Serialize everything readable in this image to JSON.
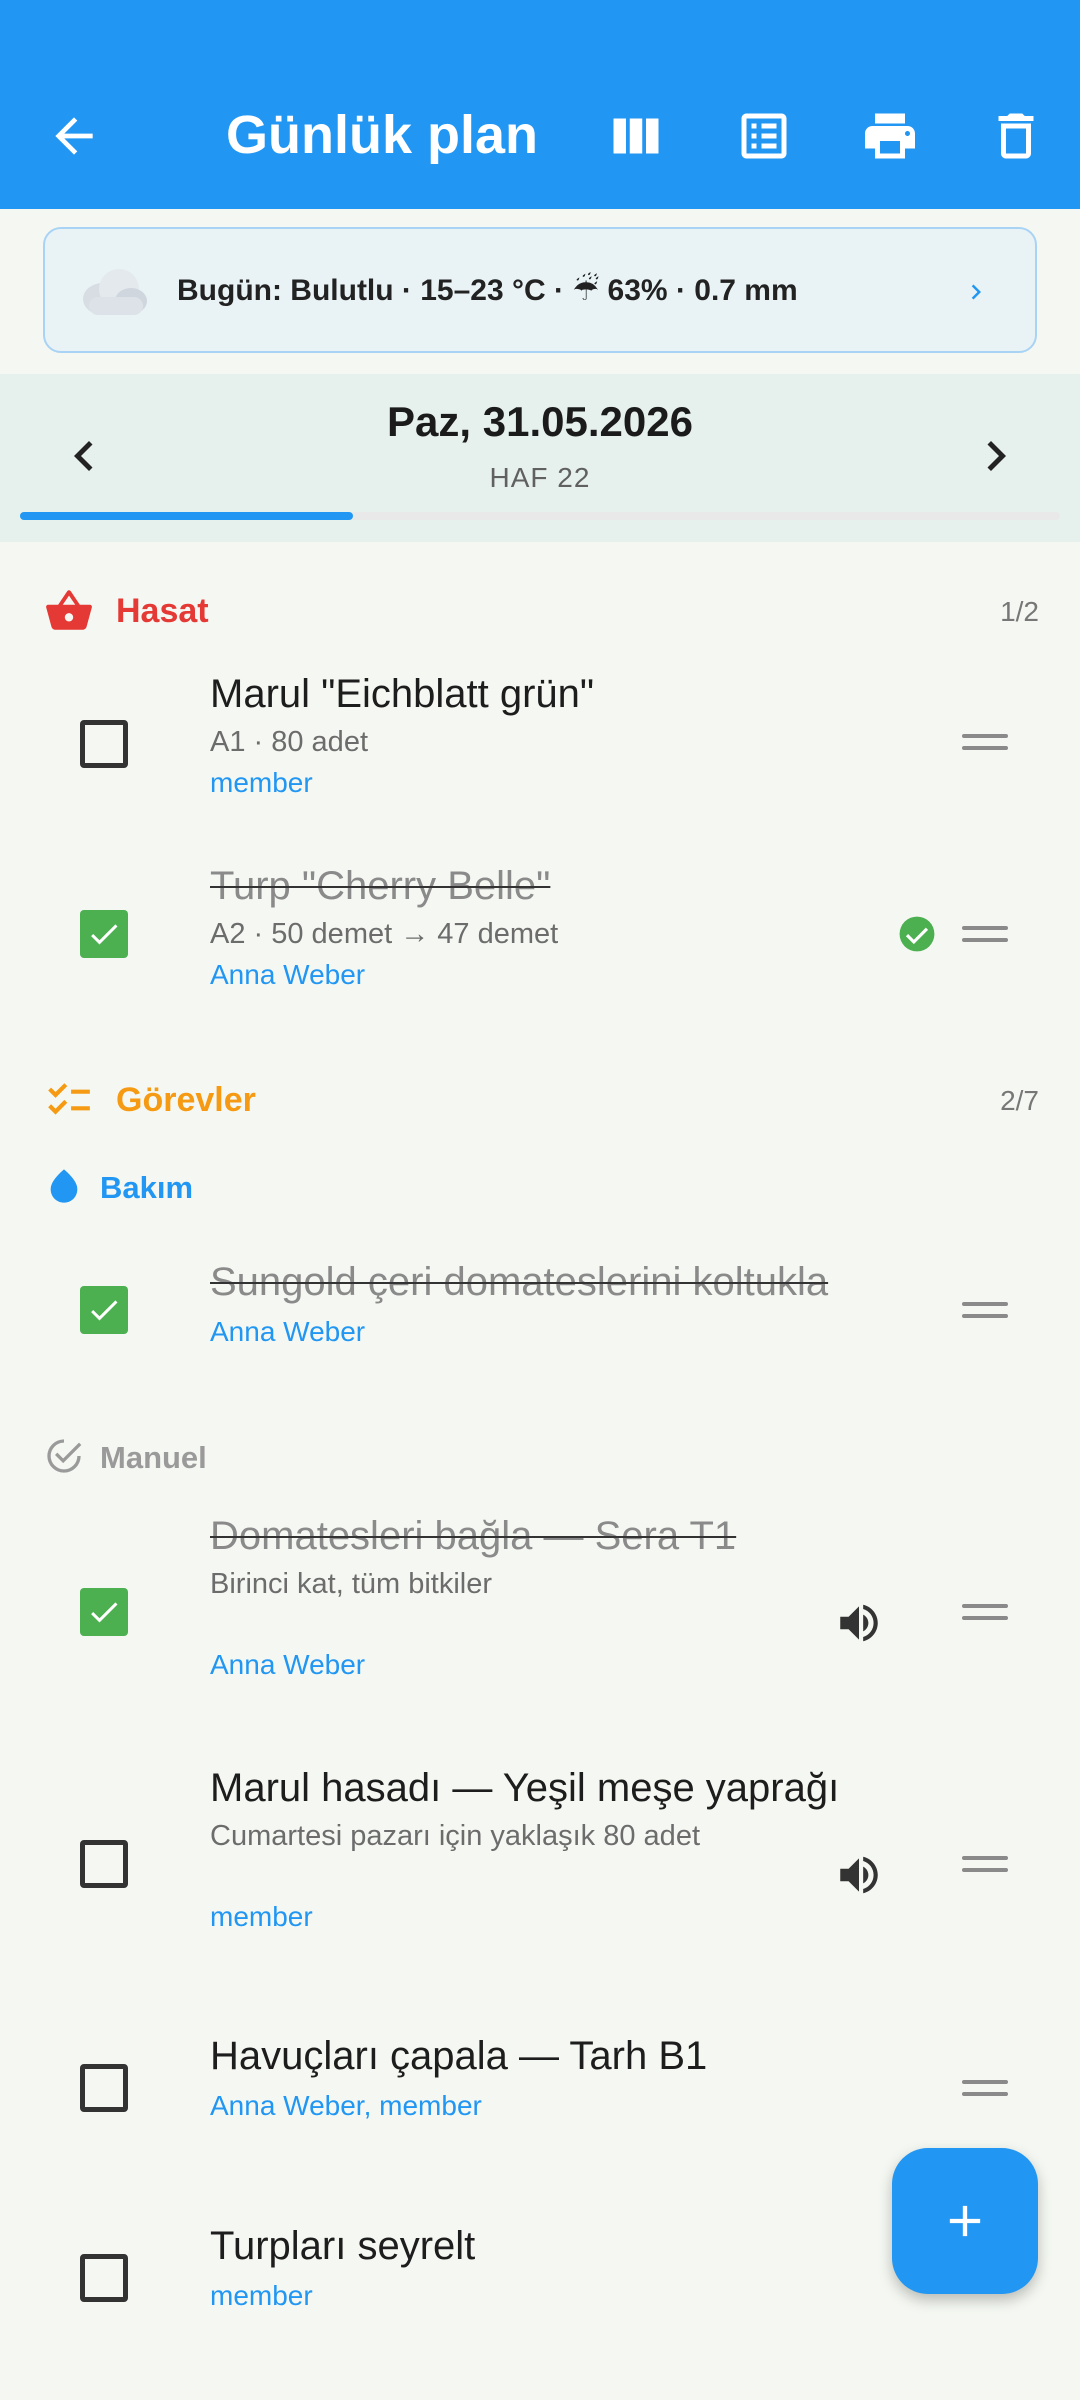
{
  "header": {
    "title": "Günlük plan",
    "bg": "#2196f3",
    "actions": [
      "columns-view-icon",
      "list-view-icon",
      "print-icon",
      "delete-icon"
    ]
  },
  "weather": {
    "text": "Bugün: Bulutlu · 15–23 °C · ☔ 63% · 0.7 mm"
  },
  "date_nav": {
    "date": "Paz, 31.05.2026",
    "week": "HAF 22",
    "progress": 0.32
  },
  "harvest": {
    "title": "Hasat",
    "count": "1/2",
    "color": "#e53935",
    "items": [
      {
        "title": "Marul \"Eichblatt grün\"",
        "sub": "A1 · 80 adet",
        "user": "member",
        "done": false
      },
      {
        "title": "Turp \"Cherry Belle\"",
        "sub": "A2 · 50 demet → 47 demet",
        "user": "Anna Weber",
        "done": true
      }
    ]
  },
  "tasks": {
    "title": "Görevler",
    "count": "2/7",
    "color": "#f59a12",
    "care": {
      "title": "Bakım",
      "items": [
        {
          "title": "Sungold çeri domateslerini koltukla",
          "user": "Anna Weber",
          "done": true
        }
      ]
    },
    "manual": {
      "title": "Manuel",
      "items": [
        {
          "title": "Domatesleri bağla — Sera T1",
          "sub": "Birinci kat, tüm bitkiler",
          "user": "Anna Weber",
          "done": true
        },
        {
          "title": "Marul hasadı — Yeşil meşe yaprağı",
          "sub": "Cumartesi pazarı için yaklaşık 80 adet",
          "user": "member",
          "done": false
        },
        {
          "title": "Havuçları çapala — Tarh B1",
          "user": "Anna Weber, member",
          "done": false
        },
        {
          "title": "Turpları seyrelt",
          "user": "member",
          "done": false
        }
      ]
    }
  }
}
